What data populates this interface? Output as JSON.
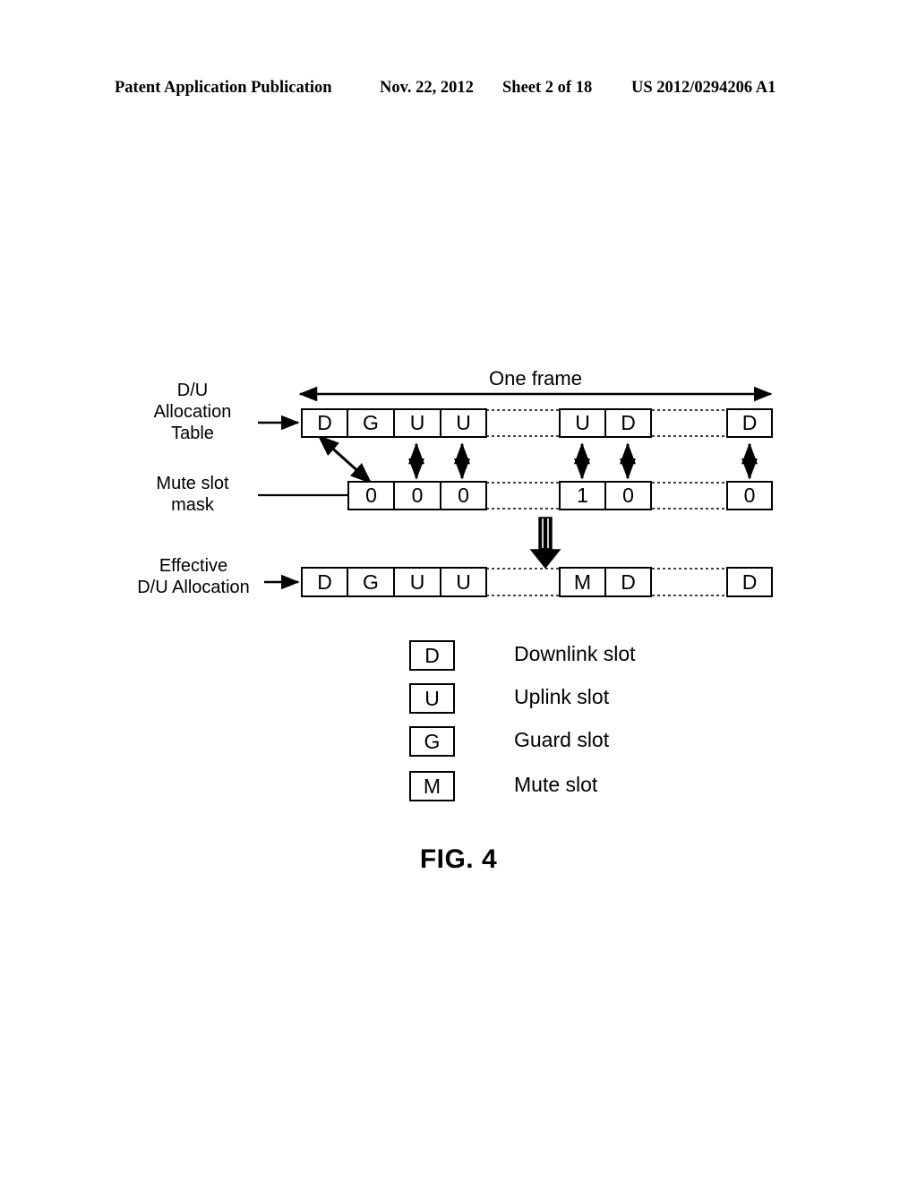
{
  "page": {
    "header": {
      "publication": "Patent Application Publication",
      "date": "Nov. 22, 2012",
      "sheet": "Sheet 2 of 18",
      "number": "US 2012/0294206 A1"
    },
    "caption": "FIG. 4"
  },
  "figure": {
    "frame_label": "One frame",
    "rows": [
      {
        "id": "du-allocation-table",
        "label": "D/U\nAllocation\nTable",
        "cells": [
          "D",
          "G",
          "U",
          "U",
          "U",
          "D",
          "D"
        ]
      },
      {
        "id": "mute-slot-mask",
        "label": "Mute slot\nmask",
        "cells": [
          "0",
          "0",
          "0",
          "1",
          "0",
          "0"
        ]
      },
      {
        "id": "effective-du-allocation",
        "label": "Effective\nD/U Allocation",
        "cells": [
          "D",
          "G",
          "U",
          "U",
          "M",
          "D",
          "D"
        ]
      }
    ],
    "legend": [
      {
        "symbol": "D",
        "text": "Downlink slot"
      },
      {
        "symbol": "U",
        "text": "Uplink slot"
      },
      {
        "symbol": "G",
        "text": "Guard slot"
      },
      {
        "symbol": "M",
        "text": "Mute slot"
      }
    ],
    "colors": {
      "ink": "#000000",
      "paper": "#ffffff"
    }
  }
}
